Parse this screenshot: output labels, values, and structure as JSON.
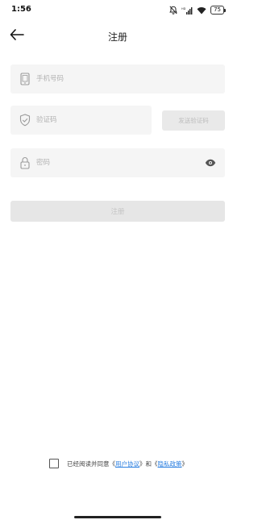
{
  "status_bar": {
    "time": "1:56",
    "battery": "75"
  },
  "header": {
    "title": "注册"
  },
  "form": {
    "phone_placeholder": "手机号码",
    "code_placeholder": "验证码",
    "send_code_label": "发送验证码",
    "password_placeholder": "密码",
    "register_label": "注册"
  },
  "agreement": {
    "prefix": "已经阅读并同意《",
    "user_agreement": "用户协议",
    "middle": "》和《",
    "privacy_policy": "隐私政策",
    "suffix": "》",
    "checked": false
  },
  "icons": {
    "back": "arrow-left-icon",
    "phone": "phone-icon",
    "code": "shield-check-icon",
    "password": "lock-icon",
    "visibility": "eye-icon"
  },
  "colors": {
    "field_bg": "#f5f5f5",
    "button_disabled_bg": "#e6e6e6",
    "link": "#2b7fe0"
  }
}
